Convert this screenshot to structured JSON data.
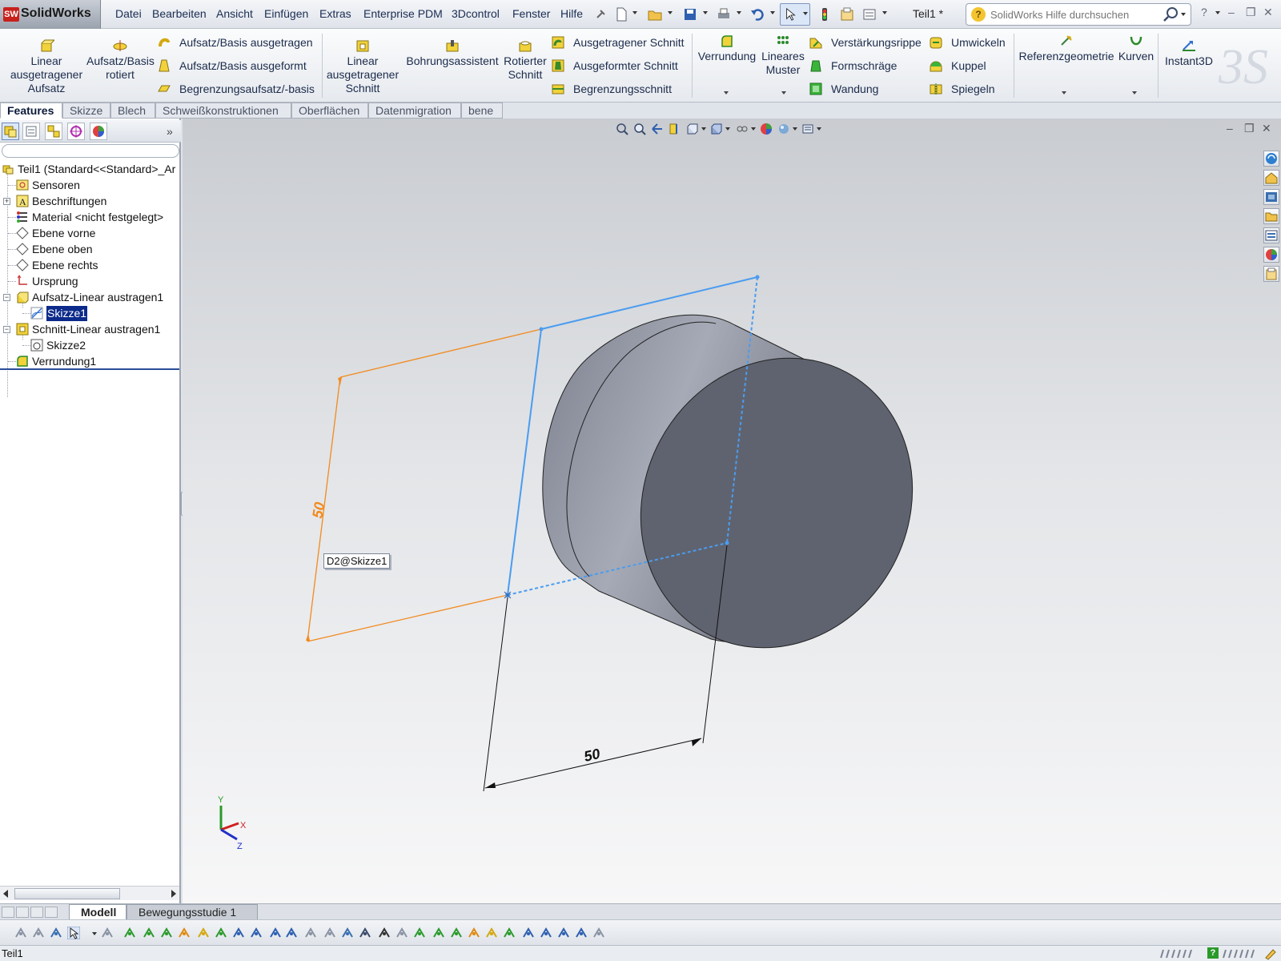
{
  "app": {
    "brand_mark": "SW",
    "brand_name": "SolidWorks",
    "document_title": "Teil1 *"
  },
  "menu": [
    "Datei",
    "Bearbeiten",
    "Ansicht",
    "Einfügen",
    "Extras",
    "Enterprise PDM",
    "3Dcontrol",
    "Fenster",
    "Hilfe"
  ],
  "help_search": {
    "placeholder": "SolidWorks Hilfe durchsuchen"
  },
  "commands": {
    "linear_boss": "Linear ausgetragener Aufsatz",
    "revolve_boss": "Aufsatz/Basis rotiert",
    "sweep_boss": "Aufsatz/Basis ausgetragen",
    "loft_boss": "Aufsatz/Basis ausgeformt",
    "boundary_boss": "Begrenzungsaufsatz/-basis",
    "linear_cut": "Linear ausgetragener Schnitt",
    "hole_wizard": "Bohrungsassistent",
    "revolve_cut": "Rotierter Schnitt",
    "sweep_cut": "Ausgetragener Schnitt",
    "loft_cut": "Ausgeformter Schnitt",
    "boundary_cut": "Begrenzungsschnitt",
    "fillet": "Verrundung",
    "linear_pattern": "Lineares Muster",
    "rib": "Verstärkungsrippe",
    "draft": "Formschräge",
    "shell": "Wandung",
    "wrap": "Umwickeln",
    "dome": "Kuppel",
    "mirror": "Spiegeln",
    "ref_geometry": "Referenzgeometrie",
    "curves": "Kurven",
    "instant3d": "Instant3D"
  },
  "tabs": [
    "Features",
    "Skizze",
    "Blech",
    "Schweißkonstruktionen",
    "Oberflächen",
    "Datenmigration",
    "bene"
  ],
  "active_tab": "Features",
  "tree": [
    {
      "label": "Teil1  (Standard<<Standard>_Ar",
      "icon": "part-icon"
    },
    {
      "label": "Sensoren",
      "icon": "sensor-icon"
    },
    {
      "label": "Beschriftungen",
      "icon": "annotation-icon"
    },
    {
      "label": "Material <nicht festgelegt>",
      "icon": "material-icon"
    },
    {
      "label": "Ebene vorne",
      "icon": "plane-icon"
    },
    {
      "label": "Ebene oben",
      "icon": "plane-icon"
    },
    {
      "label": "Ebene rechts",
      "icon": "plane-icon"
    },
    {
      "label": "Ursprung",
      "icon": "origin-icon"
    },
    {
      "label": "Aufsatz-Linear austragen1",
      "icon": "extrude-icon"
    },
    {
      "label": "Skizze1",
      "icon": "sketch-icon",
      "selected": true
    },
    {
      "label": "Schnitt-Linear austragen1",
      "icon": "cut-extrude-icon"
    },
    {
      "label": "Skizze2",
      "icon": "sketch-icon"
    },
    {
      "label": "Verrundung1",
      "icon": "fillet-icon"
    }
  ],
  "viewport": {
    "dim_bottom": "50",
    "dim_left": "50",
    "dim_tag": "D2@Skizze1",
    "triad": {
      "x": "X",
      "y": "Y",
      "z": "Z"
    }
  },
  "bottom_tabs": [
    "Modell",
    "Bewegungsstudie 1"
  ],
  "status": {
    "left": "Teil1"
  },
  "colors": {
    "selection_blue": "#4a9cf0",
    "dimension_orange": "#f28a1e",
    "tree_selected": "#0b2a8a",
    "body_gray": "#6a6e7a"
  }
}
